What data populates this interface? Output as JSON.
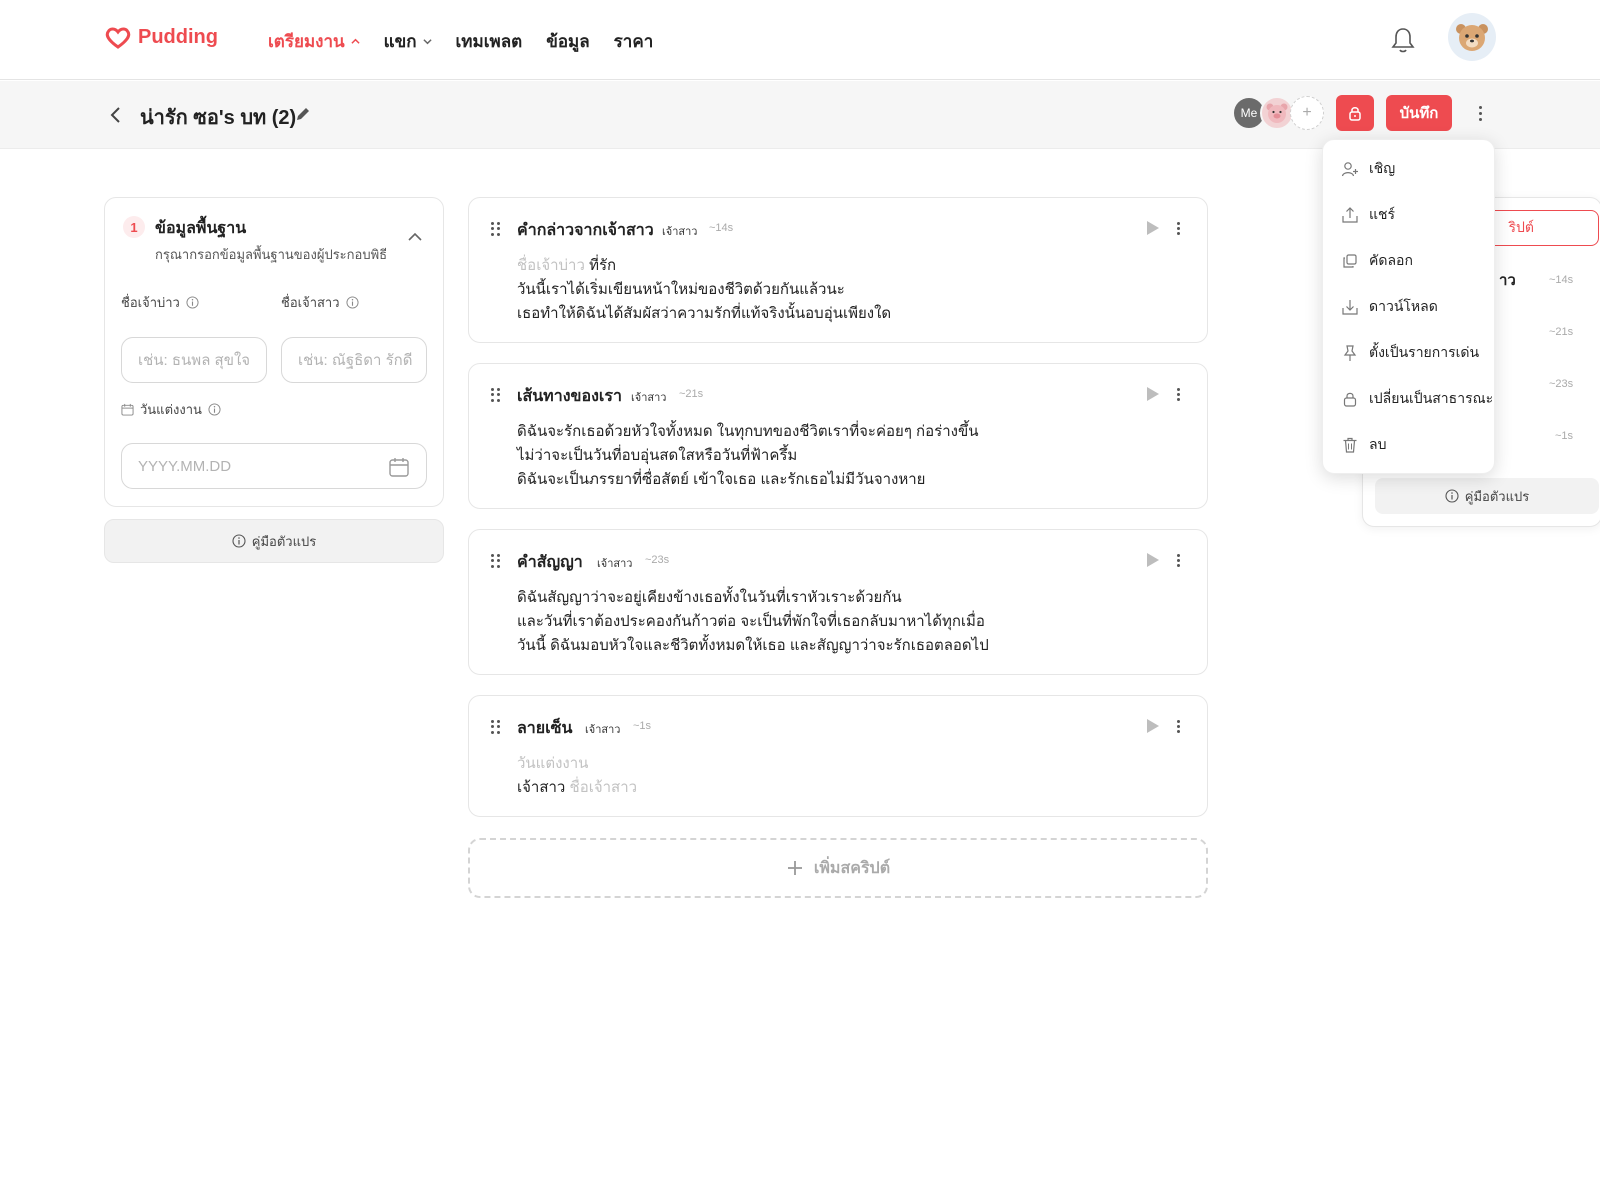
{
  "brand": {
    "name": "Pudding",
    "accent": "#ee4b50"
  },
  "nav": {
    "items": [
      {
        "label": "เตรียมงาน",
        "active": true,
        "chevron": "up"
      },
      {
        "label": "แขก",
        "active": false,
        "chevron": "down"
      },
      {
        "label": "เทมเพลต",
        "active": false
      },
      {
        "label": "ข้อมูล",
        "active": false
      },
      {
        "label": "ราคา",
        "active": false
      }
    ]
  },
  "header": {
    "title": "น่ารัก ซอ's บท (2)",
    "collaborators": [
      "Me",
      "pig-avatar"
    ],
    "add_collaborator": "+",
    "save_label": "บันทึก"
  },
  "basic_info": {
    "step": "1",
    "title": "ข้อมูลพื้นฐาน",
    "subtitle": "กรุณากรอกข้อมูลพื้นฐานของผู้ประกอบพิธี",
    "groom_label": "ชื่อเจ้าบ่าว",
    "bride_label": "ชื่อเจ้าสาว",
    "groom_placeholder": "เช่น: ธนพล สุขใจ",
    "bride_placeholder": "เช่น: ณัฐธิดา รักดี",
    "date_label": "วันแต่งงาน",
    "date_placeholder": "YYYY.MM.DD",
    "guide_label": "คู่มือตัวแปร"
  },
  "scripts": [
    {
      "title": "คำกล่าวจากเจ้าสาว",
      "role": "เจ้าสาว",
      "duration": "~14s",
      "line1_var": "ชื่อเจ้าบ่าว",
      "line1_text": " ที่รัก",
      "line2": "วันนี้เราได้เริ่มเขียนหน้าใหม่ของชีวิตด้วยกันแล้วนะ",
      "line3": "เธอทำให้ดิฉันได้สัมผัสว่าความรักที่แท้จริงนั้นอบอุ่นเพียงใด"
    },
    {
      "title": "เส้นทางของเรา",
      "role": "เจ้าสาว",
      "duration": "~21s",
      "line1": "ดิฉันจะรักเธอด้วยหัวใจทั้งหมด ในทุกบทของชีวิตเราที่จะค่อยๆ ก่อร่างขึ้น",
      "line2": "ไม่ว่าจะเป็นวันที่อบอุ่นสดใสหรือวันที่ฟ้าครึ้ม",
      "line3": "ดิฉันจะเป็นภรรยาที่ซื่อสัตย์ เข้าใจเธอ และรักเธอไม่มีวันจางหาย"
    },
    {
      "title": "คำสัญญา",
      "role": "เจ้าสาว",
      "duration": "~23s",
      "line1": "ดิฉันสัญญาว่าจะอยู่เคียงข้างเธอทั้งในวันที่เราหัวเราะด้วยกัน",
      "line2": "และวันที่เราต้องประคองกันก้าวต่อ จะเป็นที่พักใจที่เธอกลับมาหาได้ทุกเมื่อ",
      "line3": "วันนี้ ดิฉันมอบหัวใจและชีวิตทั้งหมดให้เธอ และสัญญาว่าจะรักเธอตลอดไป"
    },
    {
      "title": "ลายเซ็น",
      "role": "เจ้าสาว",
      "duration": "~1s",
      "line1_var": "วันแต่งงาน",
      "line2_text": "เจ้าสาว ",
      "line2_var": "ชื่อเจ้าสาว"
    }
  ],
  "add_script_label": "เพิ่มสคริปต์",
  "right_panel": {
    "button_label": "ริปต์",
    "first_item": "าว",
    "durations": [
      "~14s",
      "~21s",
      "~23s",
      "~1s"
    ],
    "guide_label": "คู่มือตัวแปร"
  },
  "menu": {
    "items": [
      {
        "label": "เชิญ",
        "icon": "invite-user-icon"
      },
      {
        "label": "แชร์",
        "icon": "share-icon"
      },
      {
        "label": "คัดลอก",
        "icon": "copy-icon"
      },
      {
        "label": "ดาวน์โหลด",
        "icon": "download-icon"
      },
      {
        "label": "ตั้งเป็นรายการเด่น",
        "icon": "pin-icon"
      },
      {
        "label": "เปลี่ยนเป็นสาธารณะ",
        "icon": "lock-icon"
      },
      {
        "label": "ลบ",
        "icon": "trash-icon"
      }
    ]
  }
}
